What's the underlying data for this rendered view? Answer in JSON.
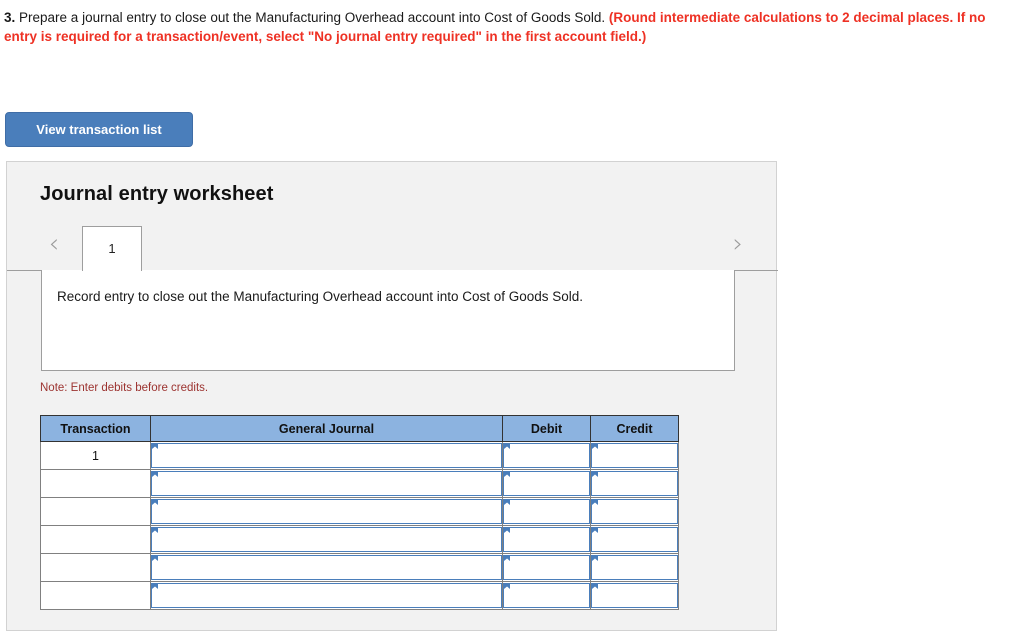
{
  "question": {
    "number": "3.",
    "body": "Prepare a journal entry to close out the Manufacturing Overhead account into Cost of Goods Sold.",
    "instruction": "(Round intermediate calculations to 2 decimal places. If no entry is required for a transaction/event, select \"No journal entry required\" in the first account field.)",
    "red_color": "#ee3124"
  },
  "toolbar": {
    "view_transaction_list_label": "View transaction list",
    "button_color": "#4a7ebb"
  },
  "worksheet": {
    "title": "Journal entry worksheet",
    "prev_icon": "chevron-left-icon",
    "next_icon": "chevron-right-icon",
    "tabs": [
      {
        "label": "1",
        "selected": true
      }
    ],
    "description": "Record entry to close out the Manufacturing Overhead account into Cost of Goods Sold.",
    "note": "Note: Enter debits before credits.",
    "note_color": "#9c3330"
  },
  "table": {
    "header_color": "#8cb3e0",
    "columns": [
      "Transaction",
      "General Journal",
      "Debit",
      "Credit"
    ],
    "rows": [
      {
        "transaction": "1",
        "general_journal": "",
        "debit": "",
        "credit": ""
      },
      {
        "transaction": "",
        "general_journal": "",
        "debit": "",
        "credit": ""
      },
      {
        "transaction": "",
        "general_journal": "",
        "debit": "",
        "credit": ""
      },
      {
        "transaction": "",
        "general_journal": "",
        "debit": "",
        "credit": ""
      },
      {
        "transaction": "",
        "general_journal": "",
        "debit": "",
        "credit": ""
      },
      {
        "transaction": "",
        "general_journal": "",
        "debit": "",
        "credit": ""
      }
    ]
  }
}
